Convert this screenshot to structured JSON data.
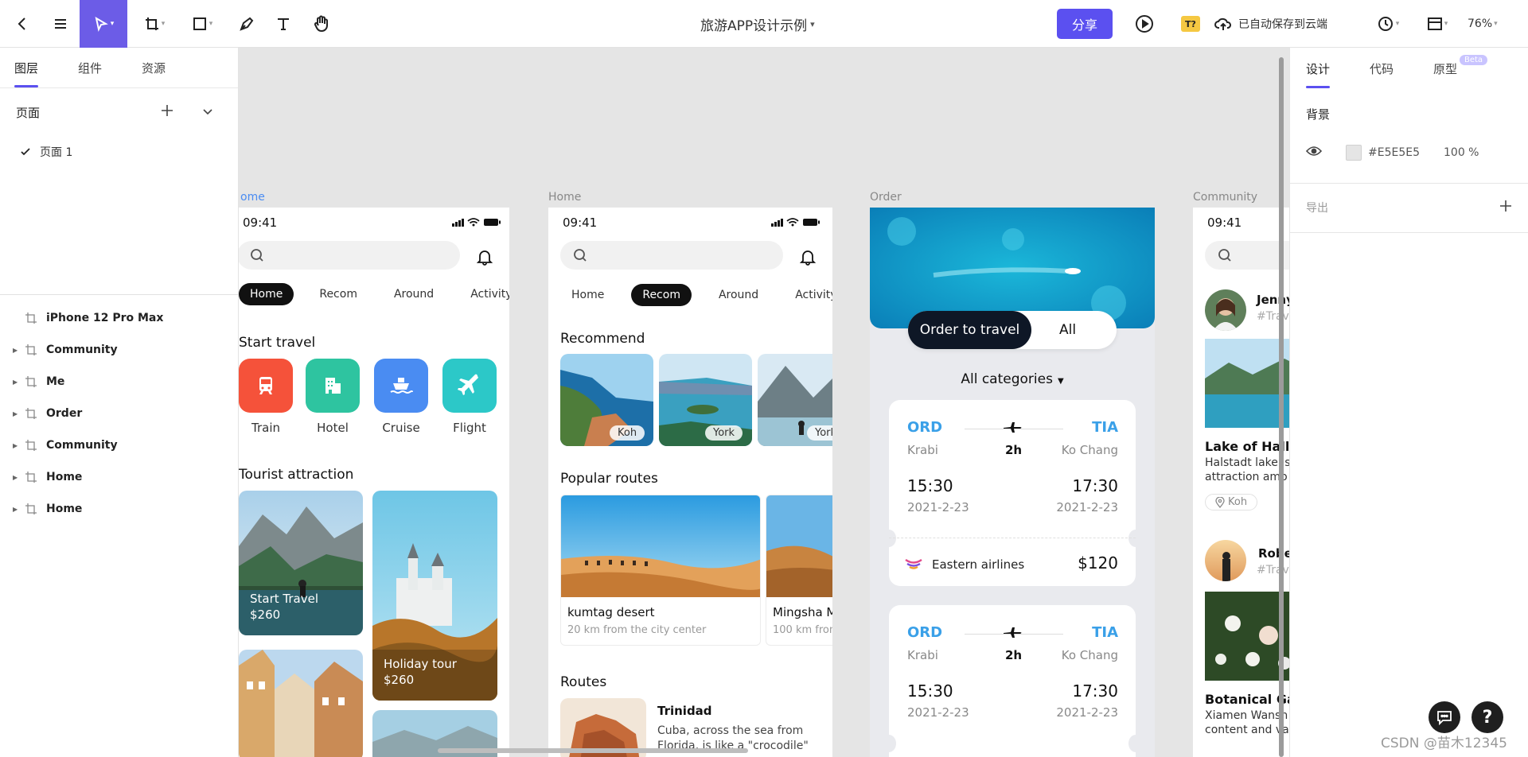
{
  "toolbar": {
    "title": "旅游APP设计示例",
    "share_label": "分享",
    "badge": "T?",
    "save_status": "已自动保存到云端",
    "zoom": "76%"
  },
  "left_panel": {
    "tabs": [
      "图层",
      "组件",
      "资源"
    ],
    "pages_label": "页面",
    "page_item": "页面 1",
    "layers": [
      "iPhone 12 Pro Max",
      "Community",
      "Me",
      "Order",
      "Community",
      "Home",
      "Home"
    ]
  },
  "right_panel": {
    "tabs": [
      "设计",
      "代码",
      "原型"
    ],
    "beta": "Beta",
    "background_label": "背景",
    "bg_hex": "#E5E5E5",
    "bg_opacity": "100 %",
    "export_label": "导出"
  },
  "canvas": {
    "frame_labels": [
      "ome",
      "Home",
      "Order",
      "Community"
    ],
    "time": "09:41",
    "home1": {
      "tabs": [
        "Home",
        "Recom",
        "Around",
        "Activity"
      ],
      "start_travel": "Start Travel",
      "section_start": "Start travel",
      "categories": [
        "Train",
        "Hotel",
        "Cruise",
        "Flight"
      ],
      "section_tourist": "Tourist attraction",
      "card1_title": "Start Travel",
      "card1_price": "$260",
      "card2_title": "Holiday tour",
      "card2_price": "$260"
    },
    "home2": {
      "tabs": [
        "Home",
        "Recom",
        "Around",
        "Activity"
      ],
      "section_recommend": "Recommend",
      "pills": [
        "Koh",
        "York",
        "York"
      ],
      "section_popular": "Popular routes",
      "route1_name": "kumtag desert",
      "route1_desc": "20 km from the city center",
      "route2_name": "Mingsha M",
      "route2_desc": "100 km from",
      "section_routes": "Routes",
      "trinidad_title": "Trinidad",
      "trinidad_desc1": "Cuba, across the sea from",
      "trinidad_desc2": "Florida, is like a \"crocodile\""
    },
    "order": {
      "btn_order": "Order to travel",
      "btn_all": "All",
      "categories": "All categories",
      "from_code": "ORD",
      "to_code": "TIA",
      "from_city": "Krabi",
      "duration": "2h",
      "to_city": "Ko Chang",
      "dep_time": "15:30",
      "arr_time": "17:30",
      "date": "2021-2-23",
      "airline": "Eastern airlines",
      "price": "$120"
    },
    "community": {
      "user1": "Jenny",
      "tag1": "#Trav",
      "post1_title": "Lake of Halls",
      "post1_l1": "Halstadt lake is",
      "post1_l2": "attraction amo",
      "loc1": "Koh",
      "user2": "Robe",
      "tag2": "#Trav",
      "post2_title": "Botanical Ga",
      "post2_l1": "Xiamen Wansh",
      "post2_l2": "content and va"
    }
  },
  "watermark": "CSDN @苗木12345",
  "colors": {
    "accent": "#5b50f0",
    "canvas_bg": "#e5e5e5",
    "train": "#f5523a",
    "hotel": "#2ec4a0",
    "cruise": "#4a8cf2",
    "flight": "#2cc8c8",
    "code_blue": "#3aa0e8"
  }
}
